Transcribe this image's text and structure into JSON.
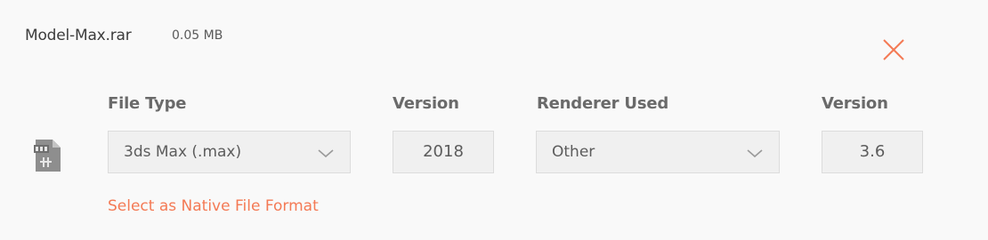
{
  "file": {
    "name": "Model-Max.rar",
    "size": "0.05 MB"
  },
  "columns": {
    "file_type_label": "File Type",
    "version_label": "Version",
    "renderer_label": "Renderer Used",
    "renderer_version_label": "Version"
  },
  "fields": {
    "file_type_value": "3ds Max (.max)",
    "version_value": "2018",
    "renderer_value": "Other",
    "renderer_version_value": "3.6"
  },
  "actions": {
    "native_format_link": "Select as Native File Format"
  },
  "colors": {
    "accent": "#f47a55",
    "background": "#f9f9f9",
    "field_background": "#f0f0f0",
    "field_border": "#dcdcdc"
  },
  "icons": {
    "file": "file-icon",
    "close": "close-icon",
    "dropdown": "chevron-down-icon"
  }
}
